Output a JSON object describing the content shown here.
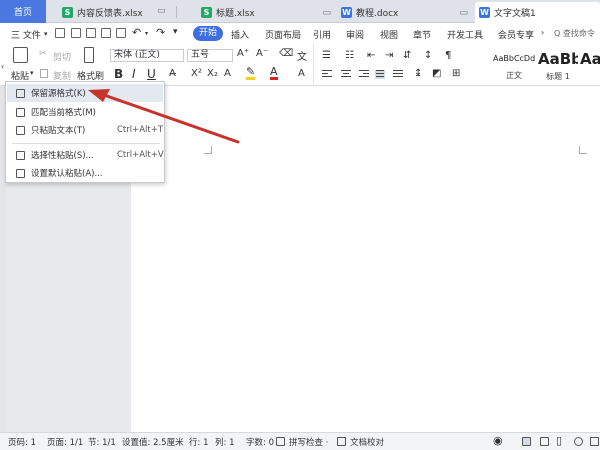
{
  "tabs": {
    "home": "首页",
    "items": [
      {
        "label": "内容反馈表.xlsx",
        "type": "S"
      },
      {
        "label": "标题.xlsx",
        "type": "S"
      },
      {
        "label": "教程.docx",
        "type": "W"
      },
      {
        "label": "文字文稿1",
        "type": "W"
      }
    ]
  },
  "menu": {
    "file": "三 文件",
    "start": "开始",
    "items": [
      "插入",
      "页面布局",
      "引用",
      "审阅",
      "视图",
      "章节",
      "开发工具",
      "会员专享"
    ],
    "search": "Q 查找命令"
  },
  "ribbon": {
    "paste": "粘贴",
    "cut": "剪切",
    "copy": "复制",
    "format_painter": "格式刷",
    "font_name": "宋体 (正文)",
    "font_size": "五号",
    "bold": "B",
    "italic": "I",
    "underline": "U",
    "styles": [
      {
        "sample": "AaBbCcDd",
        "label": "正文"
      },
      {
        "sample": "AaBb",
        "label": "标题 1"
      },
      {
        "sample": "AaI",
        "label": ""
      }
    ]
  },
  "paste_menu": {
    "items": [
      {
        "label": "保留源格式(K)",
        "shortcut": ""
      },
      {
        "label": "匹配当前格式(M)",
        "shortcut": ""
      },
      {
        "label": "只粘贴文本(T)",
        "shortcut": "Ctrl+Alt+T"
      },
      {
        "label": "选择性粘贴(S)...",
        "shortcut": "Ctrl+Alt+V"
      },
      {
        "label": "设置默认粘贴(A)...",
        "shortcut": ""
      }
    ]
  },
  "status": {
    "page": "页码: 1",
    "pages": "页面: 1/1",
    "section": "节: 1/1",
    "setting": "设置值: 2.5厘米",
    "row": "行: 1",
    "col": "列: 1",
    "words": "字数: 0",
    "spell": "拼写检查 ·",
    "proof": "文档校对"
  },
  "colors": {
    "accent": "#3e6fe0",
    "arrow": "#c8322d",
    "highlight": "#e4e8f0"
  }
}
